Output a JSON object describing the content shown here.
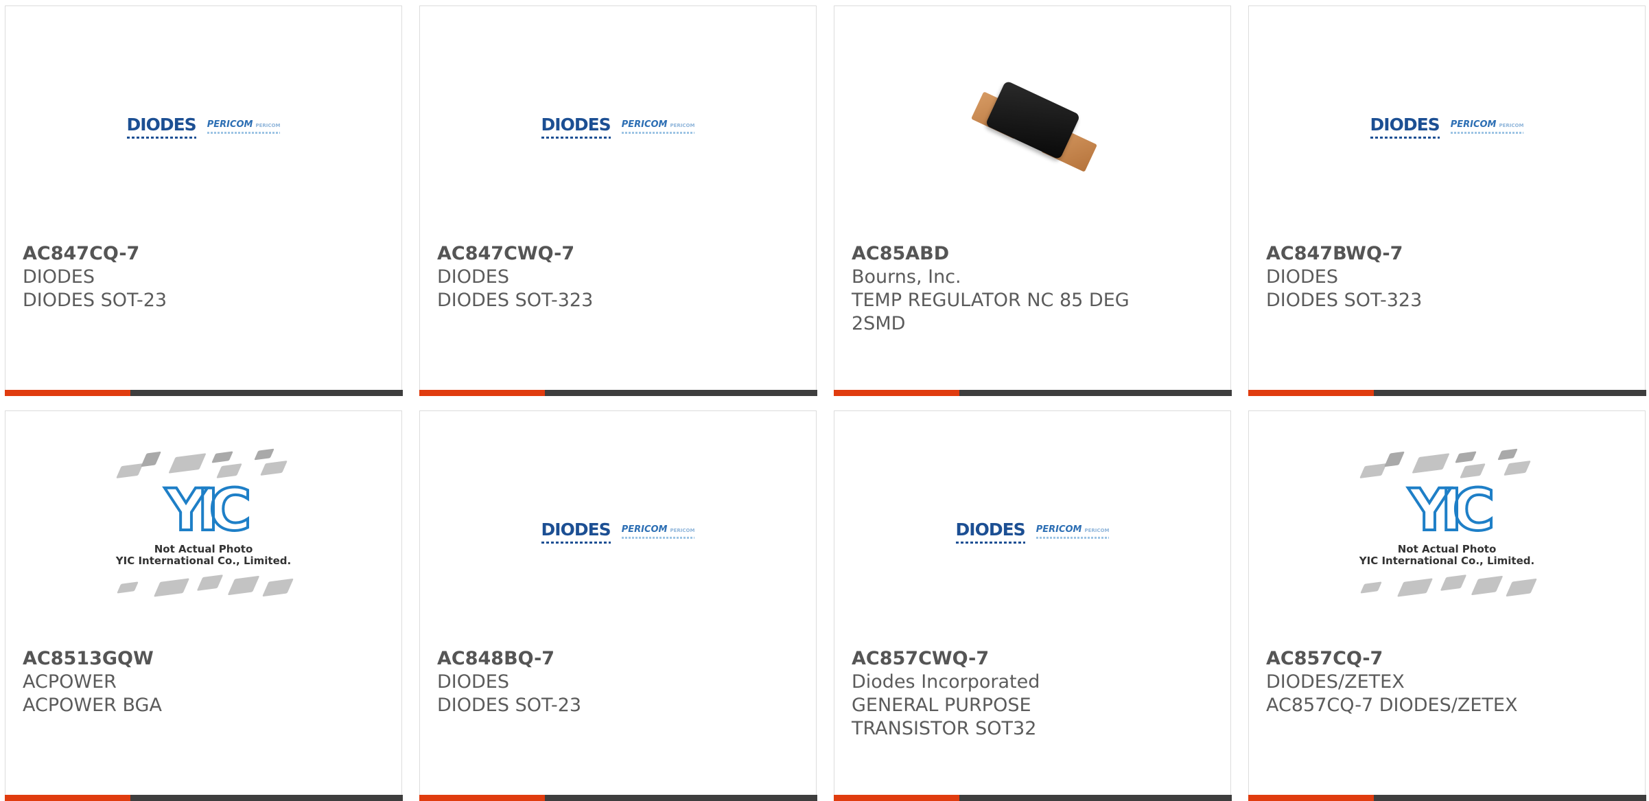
{
  "cards": [
    {
      "part_number": "AC847CQ-7",
      "manufacturer": "DIODES",
      "description": "DIODES SOT-23",
      "image": "diodes-pericom-logo"
    },
    {
      "part_number": "AC847CWQ-7",
      "manufacturer": "DIODES",
      "description": "DIODES SOT-323",
      "image": "diodes-pericom-logo"
    },
    {
      "part_number": "AC85ABD",
      "manufacturer": "Bourns, Inc.",
      "description": "TEMP REGULATOR NC 85 DEG 2SMD",
      "image": "thermostat-photo"
    },
    {
      "part_number": "AC847BWQ-7",
      "manufacturer": "DIODES",
      "description": "DIODES SOT-323",
      "image": "diodes-pericom-logo"
    },
    {
      "part_number": "AC8513GQW",
      "manufacturer": "ACPOWER",
      "description": "ACPOWER BGA",
      "image": "yic-placeholder"
    },
    {
      "part_number": "AC848BQ-7",
      "manufacturer": "DIODES",
      "description": "DIODES SOT-23",
      "image": "diodes-pericom-logo"
    },
    {
      "part_number": "AC857CWQ-7",
      "manufacturer": "Diodes Incorporated",
      "description": "GENERAL PURPOSE TRANSISTOR SOT32",
      "image": "diodes-pericom-logo"
    },
    {
      "part_number": "AC857CQ-7",
      "manufacturer": "DIODES/ZETEX",
      "description": "AC857CQ-7 DIODES/ZETEX",
      "image": "yic-placeholder"
    }
  ],
  "logo": {
    "diodes": "DIODES",
    "pericom": "PERICOM",
    "pericom_tag": "PERICOM"
  },
  "yic": {
    "mark": "YIC",
    "caption_line1": "Not Actual Photo",
    "caption_line2": "YIC International Co., Limited."
  },
  "colors": {
    "accent": "#e03c0f",
    "bar": "#3e3e3e",
    "text": "#5b5b5b",
    "diodes_blue": "#1c4f93",
    "yic_blue": "#1e7fc7"
  }
}
